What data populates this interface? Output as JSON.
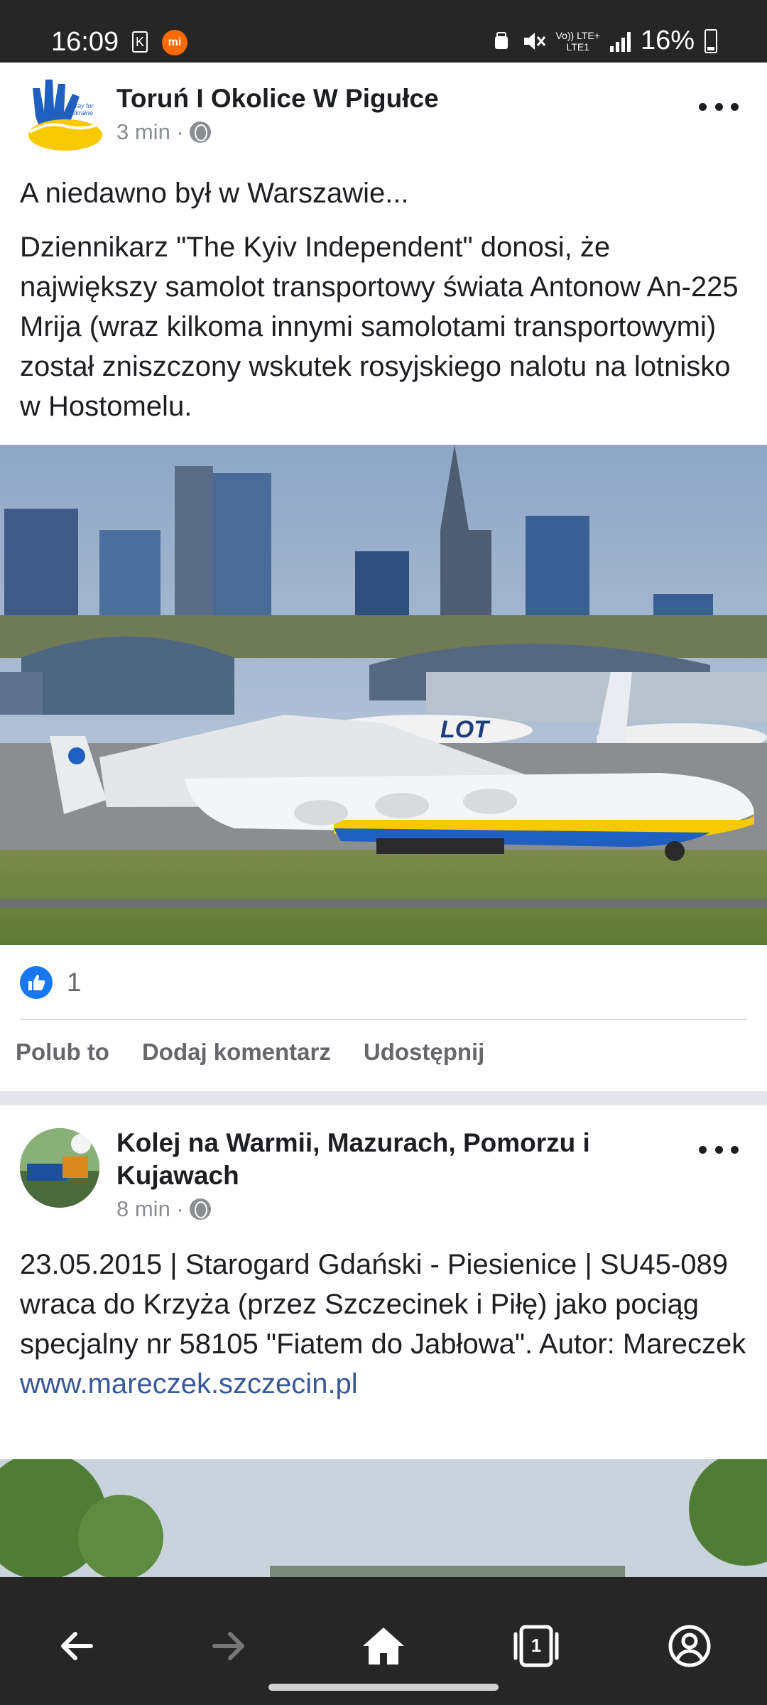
{
  "status_bar": {
    "time": "16:09",
    "k_icon": "K",
    "mi_icon": "mi",
    "network_top": "Vo)) LTE+",
    "network_bottom": "LTE1",
    "battery": "16%"
  },
  "posts": [
    {
      "author": "Toruń I Okolice W Pigułce",
      "time": "3 min ·",
      "headline": "A niedawno był w Warszawie...",
      "body": "Dziennikarz \"The Kyiv Independent\" donosi, że największy samolot transportowy świata Antonow An-225 Mrija (wraz kilkoma innymi samolotami transportowymi) został zniszczony wskutek rosyjskiego nalotu na lotnisko w Hostomelu.",
      "avatar_text": "Pray for Ukraine",
      "image_labels": {
        "tail_text": "LOT"
      },
      "like_count": "1",
      "actions": {
        "like": "Polub to",
        "comment": "Dodaj komentarz",
        "share": "Udostępnij"
      }
    },
    {
      "author_line1": "Kolej na Warmii, Mazurach, Pomorzu i",
      "author_line2": "Kujawach",
      "time": "8 min ·",
      "body": "23.05.2015 | Starogard Gdański - Piesienice | SU45-089 wraca do Krzyża (przez Szczecinek i Piłę) jako pociąg specjalny nr 58105 \"Fiatem do Jabłowa\". Autor: Mareczek",
      "link": "www.mareczek.szczecin.pl"
    }
  ],
  "bottom_nav": {
    "tab_count": "1"
  },
  "icons": {
    "back": "arrow-left-icon",
    "forward": "arrow-right-icon",
    "home": "home-icon",
    "tabs": "tabs-icon",
    "profile": "profile-icon"
  },
  "colors": {
    "brand_blue": "#1877f2",
    "link_blue": "#385898",
    "meta_gray": "#8a8d91",
    "ukraine_blue": "#1f5fbf",
    "ukraine_yellow": "#f6c900"
  }
}
